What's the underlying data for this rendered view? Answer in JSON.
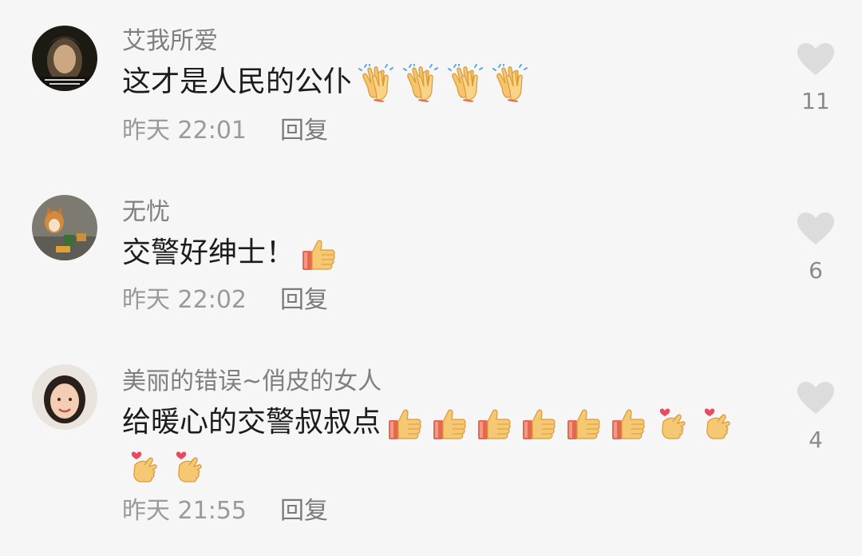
{
  "comments": [
    {
      "username": "艾我所爱",
      "text": "这才是人民的公仆",
      "emojis": [
        "clap",
        "clap",
        "clap",
        "clap"
      ],
      "time": "昨天 22:01",
      "reply_label": "回复",
      "likes": "11"
    },
    {
      "username": "无忧",
      "text": "交警好绅士！",
      "emojis": [
        "thumbs-up"
      ],
      "time": "昨天 22:02",
      "reply_label": "回复",
      "likes": "6"
    },
    {
      "username": "美丽的错误~俏皮的女人",
      "text": "给暖心的交警叔叔点",
      "emojis": [
        "thumbs-up",
        "thumbs-up",
        "thumbs-up",
        "thumbs-up",
        "thumbs-up",
        "thumbs-up",
        "finger-heart",
        "finger-heart"
      ],
      "emojis_line2": [
        "finger-heart",
        "finger-heart"
      ],
      "time": "昨天 21:55",
      "reply_label": "回复",
      "likes": "4"
    }
  ],
  "colors": {
    "background": "#f6f6f6",
    "heart": "#dcdcdc",
    "emoji_skin": "#f7c873",
    "emoji_cuff": "#e8674f"
  }
}
